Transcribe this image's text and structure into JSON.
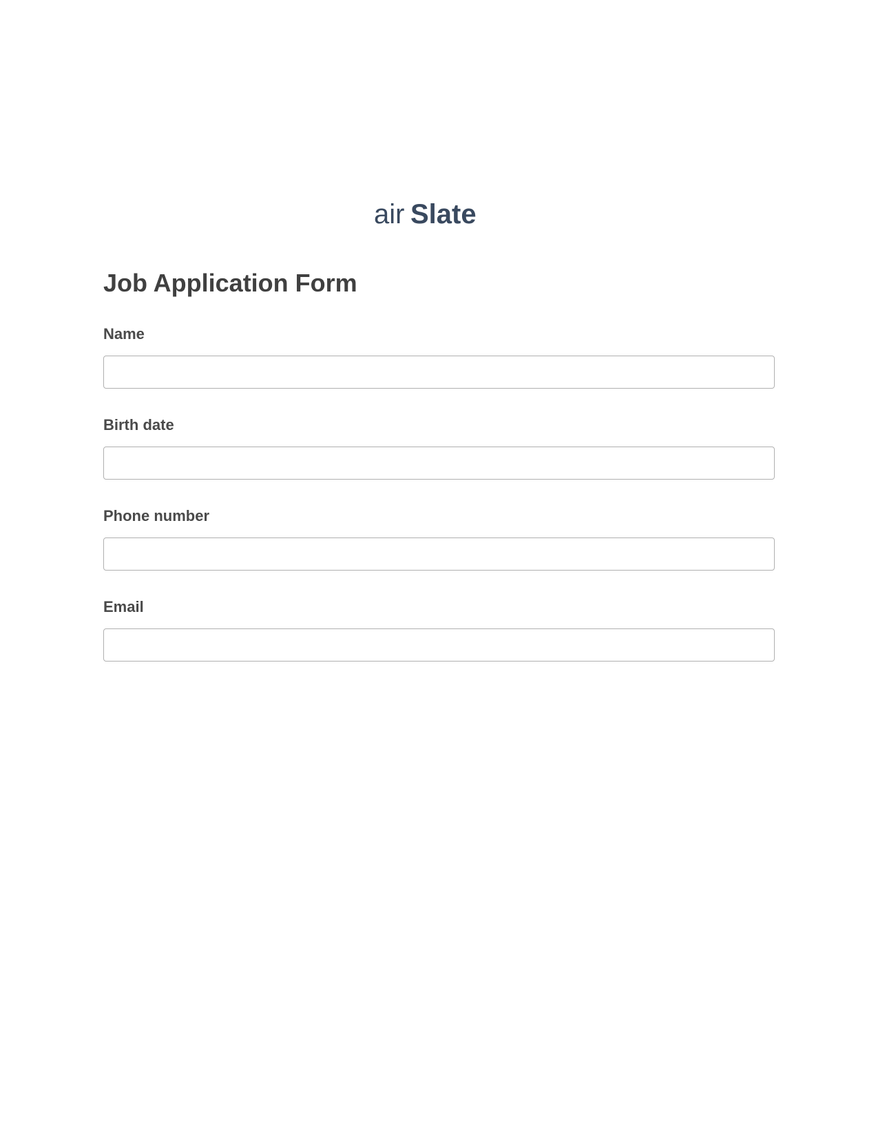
{
  "logo": {
    "text_part1": "air",
    "text_part2": "Slate",
    "color": "#39495f"
  },
  "form": {
    "title": "Job Application Form",
    "fields": [
      {
        "label": "Name",
        "value": ""
      },
      {
        "label": "Birth date",
        "value": ""
      },
      {
        "label": "Phone number",
        "value": ""
      },
      {
        "label": "Email",
        "value": ""
      }
    ]
  }
}
